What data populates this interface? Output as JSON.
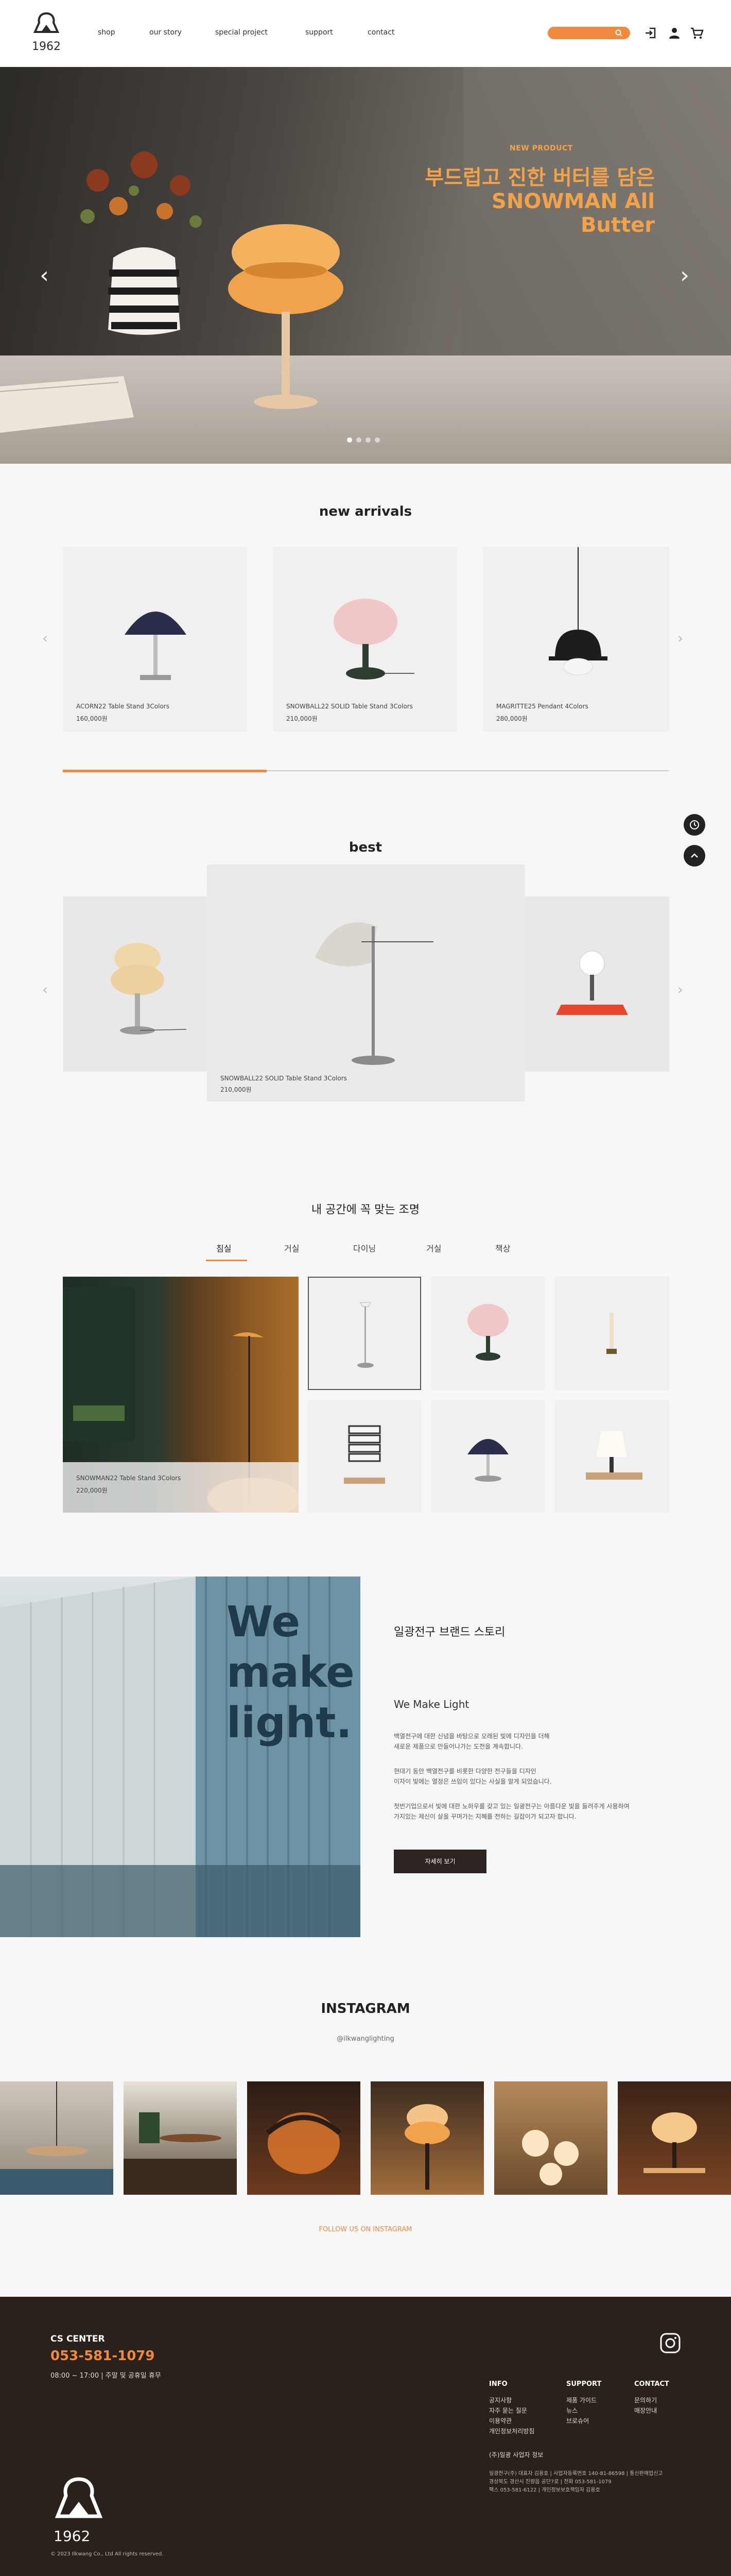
{
  "header": {
    "brand": "1962",
    "nav": [
      "shop",
      "our story",
      "special project",
      "support",
      "contact"
    ]
  },
  "hero": {
    "kicker": "NEW PRODUCT",
    "title_line1": "부드럽고 진한 버터를 담은",
    "title_line2": "SNOWMAN All Butter",
    "slide_count": 4,
    "active_slide": 1
  },
  "new_arrivals": {
    "title": "new arrivals",
    "items": [
      {
        "name": "ACORN22 Table Stand 3Colors",
        "price": "160,000원"
      },
      {
        "name": "SNOWBALL22 SOLID Table Stand 3Colors",
        "price": "210,000원"
      },
      {
        "name": "MAGRITTE25 Pendant 4Colors",
        "price": "280,000원"
      }
    ]
  },
  "best": {
    "title": "best",
    "featured": {
      "name": "SNOWBALL22 SOLID Table Stand 3Colors",
      "price": "210,000원"
    }
  },
  "room": {
    "title": "내 공간에 꼭 맞는 조명",
    "tabs": [
      "침실",
      "거실",
      "다이닝",
      "거실",
      "책상"
    ],
    "active_tab": 0,
    "featured": {
      "name": "SNOWMAN22 Table Stand 3Colors",
      "price": "220,000원"
    }
  },
  "brand": {
    "title": "일광전구 브랜드 스토리",
    "subtitle": "We Make Light",
    "p1_line1": "백열전구에 대한 신념을 바탕으로 오래된 빛에 디자인을 더해",
    "p1_line2": "새로운 제품으로 만들어나가는 도전을 계속합니다.",
    "p2_line1": "현대기 동안 백열전구를 비롯한 다양한 전구들을 디자인",
    "p2_line2": "이자이 빛에는 열정은 쓰임이 있다는 사실을 알게 되었습니다.",
    "p3_line1": "첫번기업으로서 빛에 대한 노하우를 갖고 있는 일광전구는 아름다운 빛을 들려주게 사용하여",
    "p3_line2": "가지있는 제신이 살을 꾸며가는 지혜를 전하는 길잡이가 되고자 합니다.",
    "button": "자세히 보기",
    "container_text": "We make light."
  },
  "instagram": {
    "title": "INSTAGRAM",
    "handle": "@ilkwanglighting",
    "follow": "FOLLOW US ON INSTAGRAM"
  },
  "footer": {
    "cs_label": "CS CENTER",
    "phone": "053-581-1079",
    "hours": "08:00 ~ 17:00  |  주말 및 공휴일 휴무",
    "info_title": "INFO",
    "info_items": [
      "공지사항",
      "자주 묻는 질문",
      "이용약관",
      "개인정보처리방침"
    ],
    "support_title": "SUPPORT",
    "support_items": [
      "제품 가이드",
      "뉴스",
      "브로슈어"
    ],
    "contact_title": "CONTACT",
    "contact_items": [
      "문의하기",
      "매장안내"
    ],
    "terms": "(주)일광 사업자 정보",
    "company_line1": "일광전구(주) 대표자 김용호 | 사업자등록번호 140-81-86598 | 통신판매업신고",
    "company_line2": "경상북도 경산시 진량읍 공단7로 | 전화 053-581-1079",
    "company_line3": "팩스 053-581-6122 | 개인정보보호책임자 김용호",
    "brand": "1962",
    "copyright": "© 2023 Ilkwang Co., Ltd All rights reserved."
  },
  "colors": {
    "accent": "#f08a3e",
    "hero_text": "#f1a34c",
    "footer_bg": "#2a211b"
  }
}
